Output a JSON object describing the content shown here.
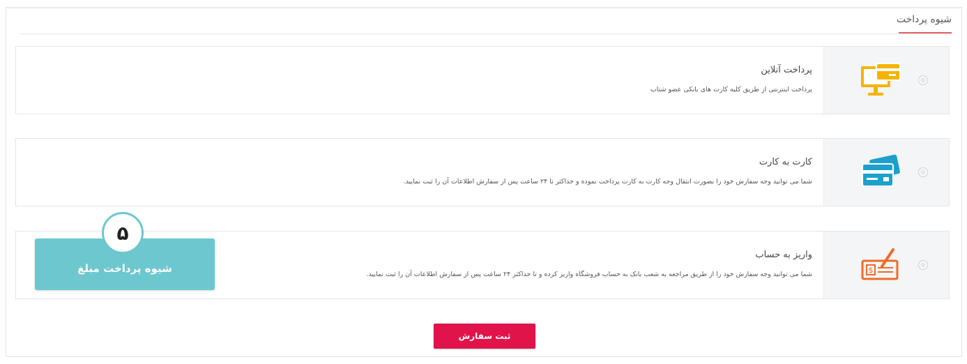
{
  "section": {
    "title": "شیوه پرداخت"
  },
  "options": [
    {
      "title": "پرداخت آنلاین",
      "description": "پرداخت اینترنتی از طریق کلیه کارت های بانکی عضو شتاب",
      "icon": "computer-card-icon",
      "icon_color": "#f4b400"
    },
    {
      "title": "کارت به کارت",
      "description": "شما می توانید وجه سفارش خود را بصورت انتقال وجه کارت به کارت پرداخت نموده و حداکثر تا ۲۴ ساعت پس از سفارش اطلاعات آن را ثبت نمایید.",
      "icon": "credit-card-icon",
      "icon_color": "#1da1cc"
    },
    {
      "title": "واریز به حساب",
      "description": "شما می توانید وجه سفارش خود را از طریق مراجعه به شعب بانک به حساب فروشگاه واریز کرده و تا حداکثر ۲۴ ساعت پس از سفارش اطلاعات آن را ثبت نمایید.",
      "icon": "cheque-icon",
      "icon_color": "#f06a2a"
    }
  ],
  "callout": {
    "number": "۵",
    "label": "شیوه پرداخت مبلغ",
    "color": "#6cc7cf"
  },
  "submit": {
    "label": "ثبت سفارش",
    "color": "#e0144a"
  }
}
